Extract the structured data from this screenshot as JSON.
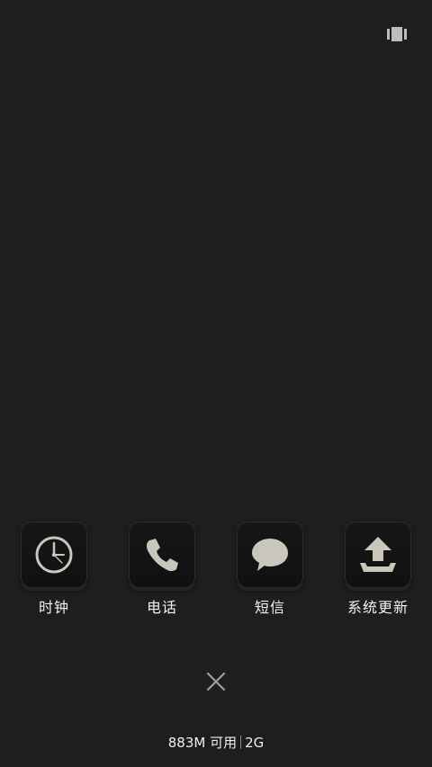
{
  "toolbar": {
    "layout_icon": "card-layout-icon"
  },
  "recents": [
    {
      "label": "时钟",
      "icon": "clock-icon"
    },
    {
      "label": "电话",
      "icon": "phone-icon"
    },
    {
      "label": "短信",
      "icon": "message-bubble-icon"
    },
    {
      "label": "系统更新",
      "icon": "upload-update-icon"
    }
  ],
  "clear": {
    "icon": "close-icon"
  },
  "memory": {
    "available": "883M 可用",
    "total": "2G"
  },
  "colors": {
    "background": "#1e1e1e",
    "icon_tile": "#131313",
    "icon_glyph": "#c9c6bc",
    "text": "#f0f0f0"
  }
}
